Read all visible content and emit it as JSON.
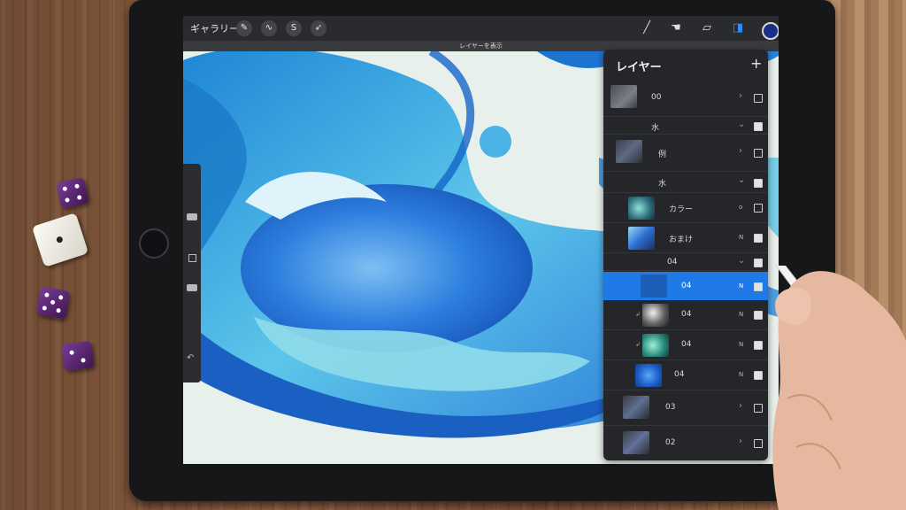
{
  "topbar": {
    "gallery_label": "ギャラリー",
    "tooltip": "レイヤーを表示"
  },
  "layers_panel": {
    "title": "レイヤー",
    "add_symbol": "+",
    "layers": [
      {
        "name": "00",
        "kind": "group",
        "checked": false,
        "active": false
      },
      {
        "name": "水",
        "kind": "group-header",
        "checked": true,
        "active": false
      },
      {
        "name": "例",
        "kind": "group",
        "checked": false,
        "active": false
      },
      {
        "name": "水",
        "kind": "group-header",
        "checked": true,
        "active": false
      },
      {
        "name": "カラー",
        "kind": "layer",
        "mode": "o",
        "checked": false,
        "active": false
      },
      {
        "name": "おまけ",
        "kind": "layer",
        "mode": "N",
        "checked": true,
        "active": false
      },
      {
        "name": "04",
        "kind": "group-header",
        "checked": true,
        "active": false
      },
      {
        "name": "04",
        "kind": "layer",
        "mode": "N",
        "checked": true,
        "active": true
      },
      {
        "name": "04",
        "kind": "layer",
        "mode": "N",
        "checked": true,
        "active": false
      },
      {
        "name": "04",
        "kind": "layer",
        "mode": "N",
        "checked": true,
        "active": false
      },
      {
        "name": "04",
        "kind": "layer",
        "mode": "N",
        "checked": true,
        "active": false
      },
      {
        "name": "03",
        "kind": "group",
        "checked": false,
        "active": false
      },
      {
        "name": "02",
        "kind": "group",
        "checked": false,
        "active": false
      }
    ]
  },
  "colors": {
    "accent": "#1f7ae8",
    "current_color": "#1c2f87",
    "wave_deep": "#1b63c7",
    "wave_light": "#5fd0e8"
  }
}
